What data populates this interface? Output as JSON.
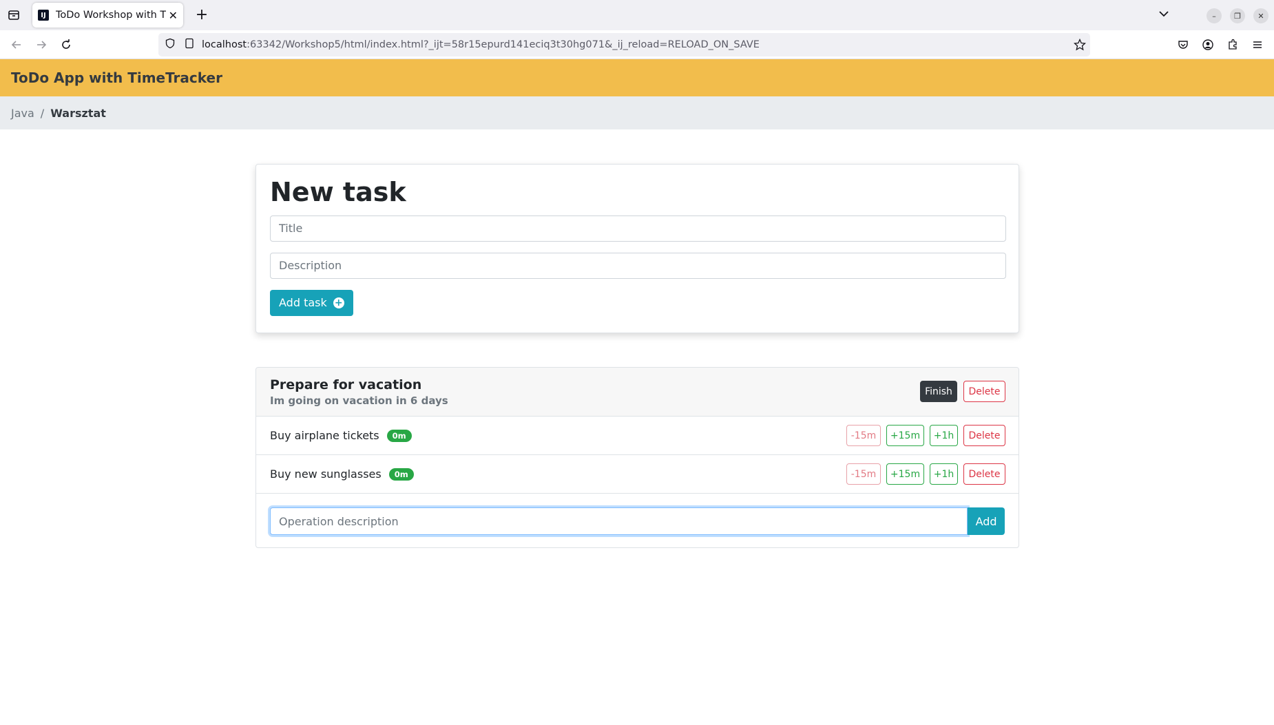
{
  "browser": {
    "tab_title": "ToDo Workshop with TimeTracker",
    "url_host": "localhost",
    "url_rest": ":63342/Workshop5/html/index.html?_ijt=58r15epurd141eciq3t30hg071&_ij_reload=RELOAD_ON_SAVE",
    "favicon_letter": "IJ"
  },
  "app": {
    "title": "ToDo App with TimeTracker"
  },
  "breadcrumb": {
    "items": [
      "Java",
      "Warsztat"
    ],
    "separator": "/"
  },
  "new_task": {
    "heading": "New task",
    "title_placeholder": "Title",
    "description_placeholder": "Description",
    "add_button_label": "Add task"
  },
  "task": {
    "name": "Prepare for vacation",
    "description": "Im going on vacation in 6 days",
    "finish_label": "Finish",
    "delete_label": "Delete",
    "operations": [
      {
        "name": "Buy airplane tickets",
        "time": "0m",
        "minus15": "-15m",
        "plus15": "+15m",
        "plus1h": "+1h",
        "delete": "Delete"
      },
      {
        "name": "Buy new sunglasses",
        "time": "0m",
        "minus15": "-15m",
        "plus15": "+15m",
        "plus1h": "+1h",
        "delete": "Delete"
      }
    ],
    "operation_placeholder": "Operation description",
    "add_operation_label": "Add"
  },
  "colors": {
    "header_bg": "#f2bd4c",
    "info": "#17a2b8",
    "success": "#28a745",
    "danger": "#dc3545",
    "dark": "#343a40"
  }
}
